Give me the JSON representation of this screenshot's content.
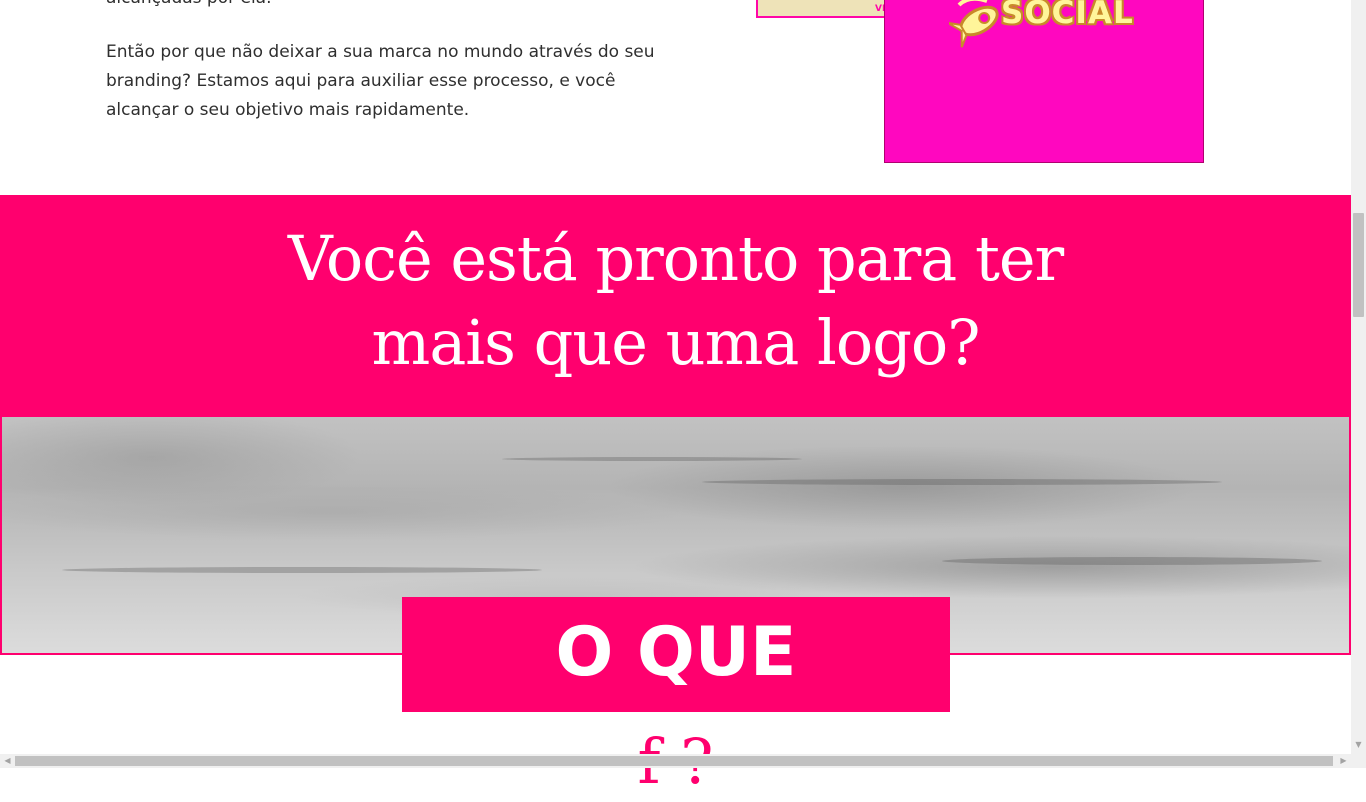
{
  "intro": {
    "line_top": "alcançadas por ela.",
    "paragraph": "Então por que não deixar a sua marca no mundo através do seu branding? Estamos aqui para auxiliar esse processo, e você alcançar o seu objetivo mais rapidamente."
  },
  "images": {
    "back_fragment": "VE",
    "logo_text": "SOCIAL",
    "logo_icon": "rocket-icon"
  },
  "cta": {
    "line1": "Você está pronto para ter",
    "line2": "mais que uma logo?"
  },
  "section": {
    "title": "O QUE",
    "next_fragment": "f      ?"
  },
  "colors": {
    "brand_pink": "#ff006e",
    "image_magenta": "#ff07bf",
    "logo_yellow": "#fff59a"
  },
  "scrollbars": {
    "left_arrow": "◀",
    "right_arrow": "▶",
    "down_arrow": "▼"
  }
}
